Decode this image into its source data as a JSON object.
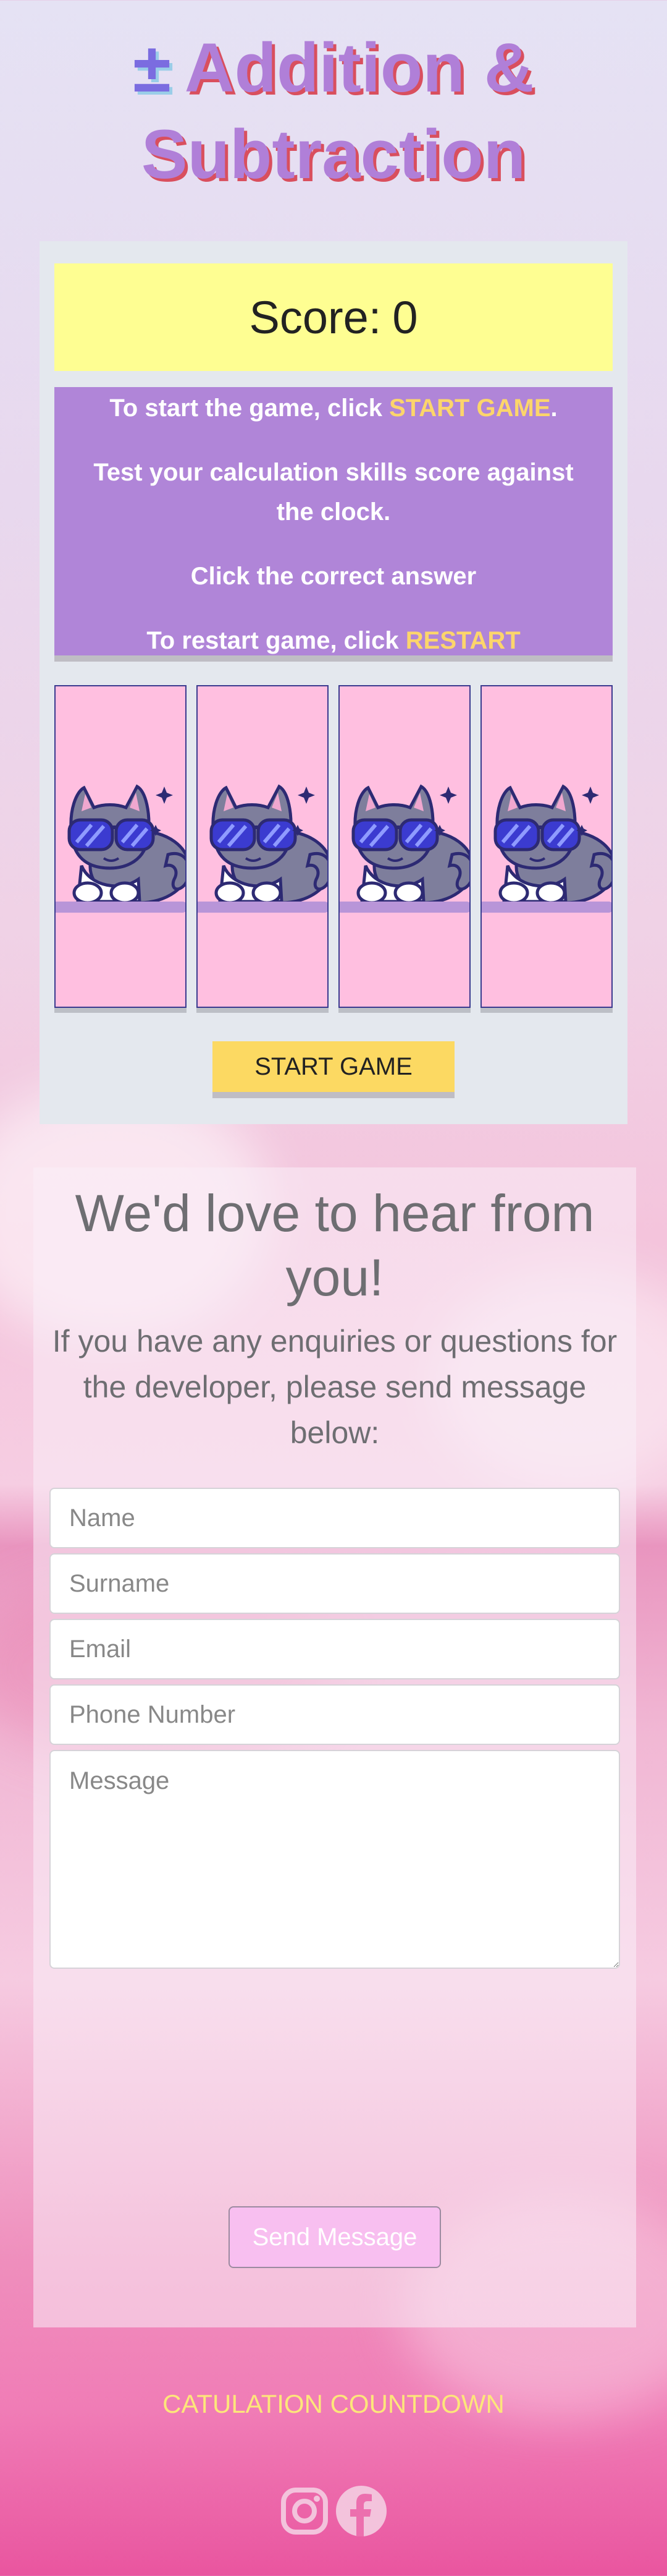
{
  "header": {
    "icon": "plus-minus-icon",
    "plus_minus": "±",
    "title": "Addition & Subtraction"
  },
  "game": {
    "score_label": "Score:",
    "score_value": "0",
    "instructions": {
      "line1_prefix": "To start the game, click",
      "line1_highlight": "START GAME",
      "line1_suffix": ".",
      "line2": "Test your calculation skills score against the clock.",
      "line3": "Click the correct answer",
      "line4_prefix": "To restart game, click",
      "line4_highlight": "RESTART"
    },
    "cards": [
      {
        "image": "cool-cat-sunglasses"
      },
      {
        "image": "cool-cat-sunglasses"
      },
      {
        "image": "cool-cat-sunglasses"
      },
      {
        "image": "cool-cat-sunglasses"
      }
    ],
    "start_button": "START GAME"
  },
  "contact": {
    "heading": "We'd love to hear from you!",
    "subheading": "If you have any enquiries or questions for the developer, please send message below:",
    "fields": {
      "name_placeholder": "Name",
      "surname_placeholder": "Surname",
      "email_placeholder": "Email",
      "phone_placeholder": "Phone Number",
      "message_placeholder": "Message"
    },
    "send_button": "Send Message"
  },
  "footer": {
    "brand": "CATULATION COUNTDOWN",
    "social_icons": [
      "instagram-icon",
      "facebook-icon"
    ]
  },
  "colors": {
    "title": "#b07fd8",
    "title_shadow": "#d94f5e",
    "score_bg": "#fefe92",
    "instructions_bg": "#b085d8",
    "highlight": "#fcd56b",
    "card_bg": "#ffbfe0",
    "start_button_bg": "#fcd962",
    "send_button_bg": "#f8bff0",
    "footer_text": "#fde67a"
  }
}
